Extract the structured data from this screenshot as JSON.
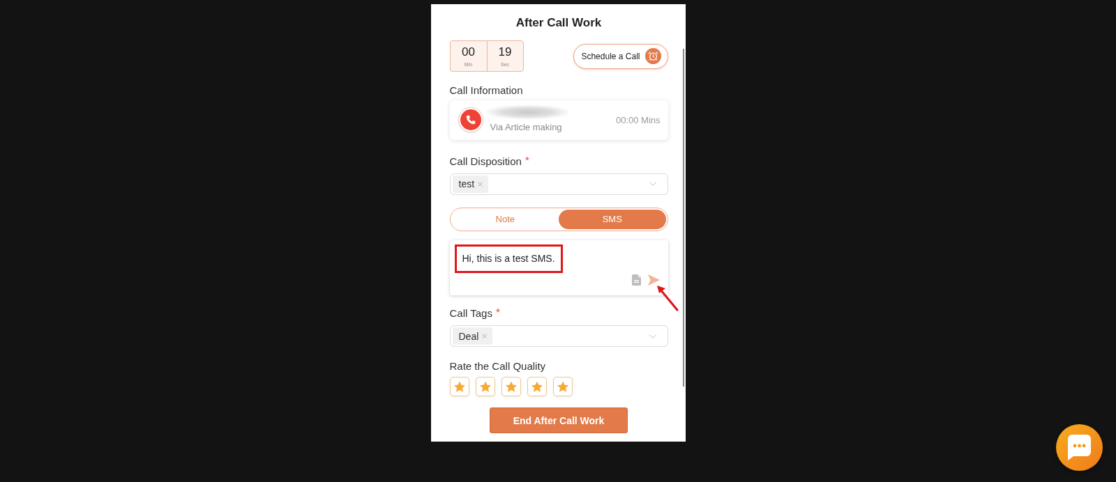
{
  "title": "After Call Work",
  "timer": [
    {
      "value": "00",
      "unit": "Min"
    },
    {
      "value": "19",
      "unit": "Sec"
    }
  ],
  "schedule_button": {
    "label": "Schedule a Call"
  },
  "call_information": {
    "label": "Call Information",
    "caller_name_blurred": true,
    "source": "Via Article making",
    "duration": "00:00 Mins"
  },
  "call_disposition": {
    "label": "Call Disposition",
    "required_mark": "*",
    "tags": [
      "test"
    ]
  },
  "mode_tabs": [
    {
      "label": "Note",
      "selected": false
    },
    {
      "label": "SMS",
      "selected": true
    }
  ],
  "sms": {
    "value": "Hi, this is a test SMS.",
    "highlighted": true,
    "pointer_arrow": true
  },
  "call_tags": {
    "label": "Call Tags",
    "required_mark": "*",
    "tags": [
      "Deal"
    ]
  },
  "rating": {
    "label": "Rate the Call Quality",
    "stars": 5
  },
  "end_button": {
    "label": "End After Call Work"
  }
}
